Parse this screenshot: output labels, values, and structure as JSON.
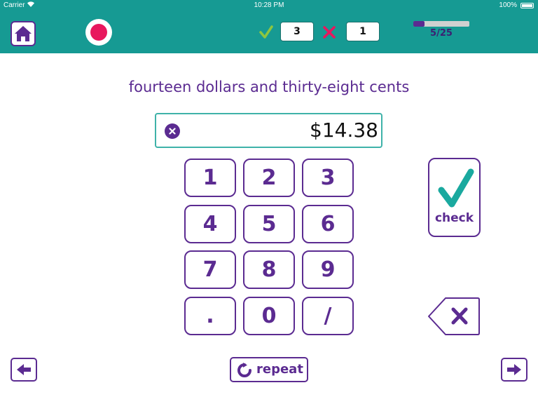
{
  "status_bar": {
    "carrier": "Carrier",
    "time": "10:28 PM",
    "battery": "100%"
  },
  "toolbar": {
    "home_icon": "home-icon",
    "record_icon": "record-icon",
    "correct_count": "3",
    "wrong_count": "1",
    "progress_text": "5/25",
    "progress_fraction": 0.2
  },
  "question": {
    "text": "fourteen dollars and thirty-eight cents"
  },
  "answer": {
    "value": "$14.38"
  },
  "keypad": {
    "keys": [
      "1",
      "2",
      "3",
      "4",
      "5",
      "6",
      "7",
      "8",
      "9",
      ".",
      "0",
      "/"
    ]
  },
  "actions": {
    "check_label": "check",
    "repeat_label": "repeat"
  },
  "colors": {
    "teal": "#169a93",
    "purple": "#5b2b91",
    "correct_green": "#8dc63f",
    "wrong_pink": "#e8175d",
    "check_teal": "#1aa99f"
  }
}
